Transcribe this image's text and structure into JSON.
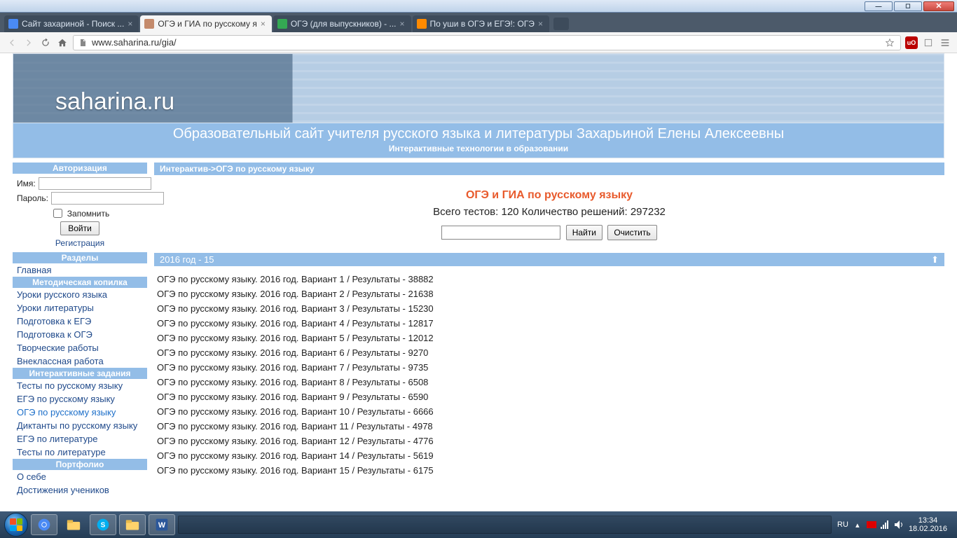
{
  "window": {
    "min": "—",
    "max": "◻",
    "close": "✕"
  },
  "tabs": [
    {
      "title": "Сайт захариной - Поиск ...",
      "fav": "#4a8af4"
    },
    {
      "title": "ОГЭ и ГИА по русскому я",
      "fav": "#c48a6b",
      "active": true
    },
    {
      "title": "ОГЭ (для выпускников) - ...",
      "fav": "#34a853"
    },
    {
      "title": "По уши в ОГЭ и ЕГЭ!: ОГЭ",
      "fav": "#ff8a00"
    }
  ],
  "toolbar": {
    "url": "www.saharina.ru/gia/",
    "page_icon": "🗋"
  },
  "banner": {
    "logo": "saharina.ru",
    "line1": "Образовательный сайт учителя русского языка и литературы Захарьиной Елены Алексеевны",
    "line2": "Интерактивные технологии в образовании"
  },
  "auth": {
    "header": "Авторизация",
    "name_label": "Имя:",
    "pass_label": "Пароль:",
    "remember": "Запомнить",
    "login_btn": "Войти",
    "register": "Регистрация"
  },
  "sections": {
    "razdely": {
      "header": "Разделы",
      "items": [
        {
          "label": "Главная"
        }
      ]
    },
    "metod": {
      "header": "Методическая копилка",
      "items": [
        {
          "label": "Уроки русского языка"
        },
        {
          "label": "Уроки литературы"
        },
        {
          "label": "Подготовка к ЕГЭ"
        },
        {
          "label": "Подготовка к ОГЭ"
        },
        {
          "label": "Творческие работы"
        },
        {
          "label": "Внеклассная работа"
        }
      ]
    },
    "inter": {
      "header": "Интерактивные задания",
      "items": [
        {
          "label": "Тесты по русскому языку"
        },
        {
          "label": "ЕГЭ по русскому языку"
        },
        {
          "label": "ОГЭ по русскому языку",
          "current": true
        },
        {
          "label": "Диктанты по русскому языку"
        },
        {
          "label": "ЕГЭ по литературе"
        },
        {
          "label": "Тесты по литературе"
        }
      ]
    },
    "port": {
      "header": "Портфолио",
      "items": [
        {
          "label": "О себе"
        },
        {
          "label": "Достижения учеников"
        }
      ]
    }
  },
  "main": {
    "breadcrumb": "Интерактив->ОГЭ по русскому языку",
    "title": "ОГЭ и ГИА по русскому языку",
    "stats": "Всего тестов: 120 Количество решений: 297232",
    "find_btn": "Найти",
    "clear_btn": "Очистить",
    "group_header": "2016 год - 15",
    "tests": [
      "ОГЭ по русскому языку. 2016 год. Вариант 1 / Результаты - 38882",
      "ОГЭ по русскому языку. 2016 год. Вариант 2 / Результаты - 21638",
      "ОГЭ по русскому языку. 2016 год. Вариант 3 / Результаты - 15230",
      "ОГЭ по русскому языку. 2016 год. Вариант 4 / Результаты - 12817",
      "ОГЭ по русскому языку. 2016 год. Вариант 5 / Результаты - 12012",
      "ОГЭ по русскому языку. 2016 год. Вариант 6 / Результаты - 9270",
      "ОГЭ по русскому языку. 2016 год. Вариант 7 / Результаты - 9735",
      "ОГЭ по русскому языку. 2016 год. Вариант 8 / Результаты - 6508",
      "ОГЭ по русскому языку. 2016 год. Вариант 9 / Результаты - 6590",
      "ОГЭ по русскому языку. 2016 год. Вариант 10 / Результаты - 6666",
      "ОГЭ по русскому языку. 2016 год. Вариант 11 / Результаты - 4978",
      "ОГЭ по русскому языку. 2016 год. Вариант 12 / Результаты - 4776",
      "ОГЭ по русскому языку. 2016 год. Вариант 14 / Результаты - 5619",
      "ОГЭ по русскому языку. 2016 год. Вариант 15 / Результаты - 6175"
    ]
  },
  "taskbar": {
    "lang": "RU",
    "time": "13:34",
    "date": "18.02.2016"
  }
}
